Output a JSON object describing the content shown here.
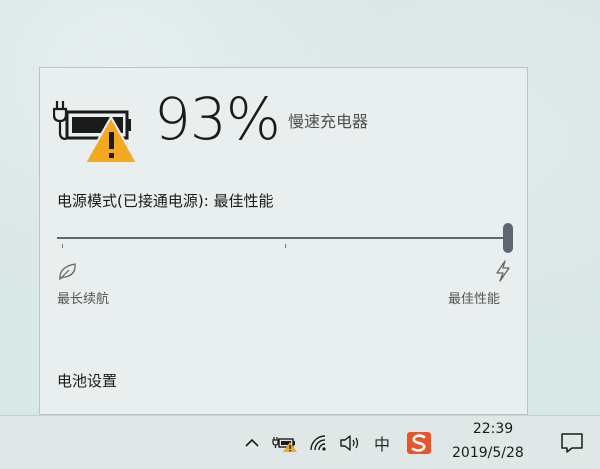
{
  "battery": {
    "percent": "93%",
    "charger_status": "慢速充电器",
    "icon": "battery-charging-warning-icon"
  },
  "power_mode": {
    "label": "电源模式(已接通电源): 最佳性能",
    "min_label": "最长续航",
    "max_label": "最佳性能",
    "level_fraction": 1.0,
    "min_icon": "leaf-icon",
    "max_icon": "bolt-icon"
  },
  "settings_link": "电池设置",
  "taskbar": {
    "tray_icons": [
      "chevron-up-icon",
      "battery-warning-icon",
      "wifi-icon",
      "speaker-icon",
      "ime-icon",
      "sogou-icon",
      "notification-icon"
    ],
    "ime_label": "中",
    "clock_time": "22:39",
    "clock_date": "2019/5/28"
  },
  "colors": {
    "warning": "#f3a91f",
    "slider": "#5e6670",
    "sogou": "#e8552a"
  }
}
